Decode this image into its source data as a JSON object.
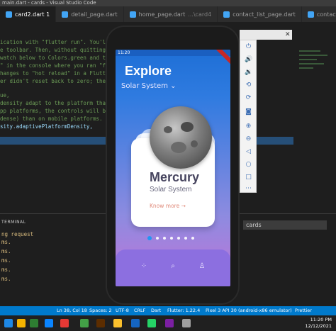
{
  "window": {
    "title": "main.dart - cards - Visual Studio Code"
  },
  "tabs": [
    {
      "label": "card2.dart 1",
      "sub": ""
    },
    {
      "label": "detail_page.dart",
      "sub": ""
    },
    {
      "label": "home_page.dart",
      "sub": "...\\card4"
    },
    {
      "label": "contact_list_page.dart",
      "sub": ""
    },
    {
      "label": "contact.dart",
      "sub": ""
    }
  ],
  "editor": {
    "lines": [
      "ication with \"flutter run\". You'll se",
      "e toolbar. Then, without quitting the",
      "watch below to Colors.green and then",
      "\" in the console where you ran \"flut",
      "hanges to \"hot reload\" in a Flutter I",
      "er didn't reset back to zero; the app",
      "ue,",
      " density adapt to the platform that y",
      "pp platforms, the controls will be sm",
      " dense) than on mobile platforms.",
      "sity.adaptivePlatformDensity,"
    ]
  },
  "panel": {
    "title": "TERMINAL",
    "lines": [
      "ng request",
      "ms.",
      "ms.",
      "ms.",
      "ms.",
      "ms."
    ],
    "dropdown": "cards"
  },
  "statusbar": {
    "position": "Ln 38, Col 18",
    "spaces": "Spaces: 2",
    "encoding": "UTF-8",
    "eol": "CRLF",
    "language": "Dart",
    "flutter": "Flutter: 1.22.4",
    "device": "Pixel 3 API 30 (android-x86 emulator)",
    "prettier": "Prettier"
  },
  "taskbar": {
    "time": "11:20 PM",
    "date": "12/12/2021"
  },
  "app": {
    "status_time": "11:20",
    "title": "Explore",
    "dropdown": "Solar System",
    "card": {
      "name": "Mercury",
      "subtitle": "Solar System",
      "link": "Know more"
    },
    "dots_count": 7
  },
  "colors": {
    "vscode_blue": "#007acc",
    "app_blue": "#1e6fd6",
    "app_purple": "#c274d8",
    "card_title": "#47455f",
    "active_dot": "#2196f3"
  },
  "icons": {
    "emulator_tools": [
      "power-icon",
      "volume-up-icon",
      "volume-down-icon",
      "rotate-left-icon",
      "rotate-right-icon",
      "camera-icon",
      "zoom-in-icon",
      "zoom-out-icon",
      "back-icon",
      "home-icon",
      "overview-icon",
      "more-icon"
    ],
    "nav": [
      "grid-icon",
      "search-icon",
      "profile-icon"
    ]
  }
}
